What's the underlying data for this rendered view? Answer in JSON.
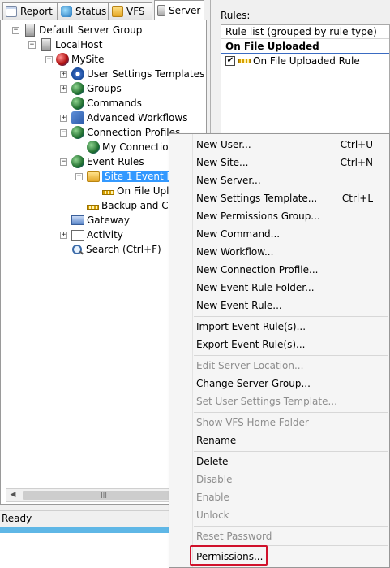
{
  "tabs": [
    {
      "label": "Report",
      "icon": "report-icon"
    },
    {
      "label": "Status",
      "icon": "status-icon"
    },
    {
      "label": "VFS",
      "icon": "vfs-icon"
    },
    {
      "label": "Server",
      "icon": "server-icon",
      "active": true
    }
  ],
  "tree": {
    "default_server_group": "Default Server Group",
    "localhost": "LocalHost",
    "mysite": "MySite",
    "user_settings_templates": "User Settings Templates",
    "groups": "Groups",
    "commands": "Commands",
    "advanced_workflows": "Advanced Workflows",
    "connection_profiles": "Connection Profiles",
    "my_connection": "My Connection",
    "event_rules": "Event Rules",
    "site1_event_rules": "Site 1 Event Rul",
    "on_file_uploaded": "On File Uplo",
    "backup_and_cleanup": "Backup and Cle",
    "gateway": "Gateway",
    "activity": "Activity",
    "search": "Search (Ctrl+F)"
  },
  "status_bar": {
    "text": "Ready"
  },
  "rules_panel": {
    "label": "Rules:",
    "list_header": "Rule list (grouped by rule type)",
    "group": "On File Uploaded",
    "item": "On File Uploaded Rule",
    "item_checked": true
  },
  "context_menu": {
    "new_user": "New User...",
    "new_user_sc": "Ctrl+U",
    "new_site": "New Site...",
    "new_site_sc": "Ctrl+N",
    "new_server": "New Server...",
    "new_settings_template": "New Settings Template...",
    "new_settings_template_sc": "Ctrl+L",
    "new_permissions_group": "New Permissions Group...",
    "new_command": "New Command...",
    "new_workflow": "New Workflow...",
    "new_connection_profile": "New Connection Profile...",
    "new_event_rule_folder": "New Event Rule Folder...",
    "new_event_rule": "New Event Rule...",
    "import_event_rules": "Import Event Rule(s)...",
    "export_event_rules": "Export Event Rule(s)...",
    "edit_server_location": "Edit Server Location...",
    "change_server_group": "Change Server Group...",
    "set_user_settings_template": "Set User Settings Template...",
    "show_vfs_home_folder": "Show VFS Home Folder",
    "rename": "Rename",
    "delete": "Delete",
    "disable": "Disable",
    "enable": "Enable",
    "unlock": "Unlock",
    "reset_password": "Reset Password",
    "permissions": "Permissions...",
    "highlight_color": "#d0112b"
  }
}
